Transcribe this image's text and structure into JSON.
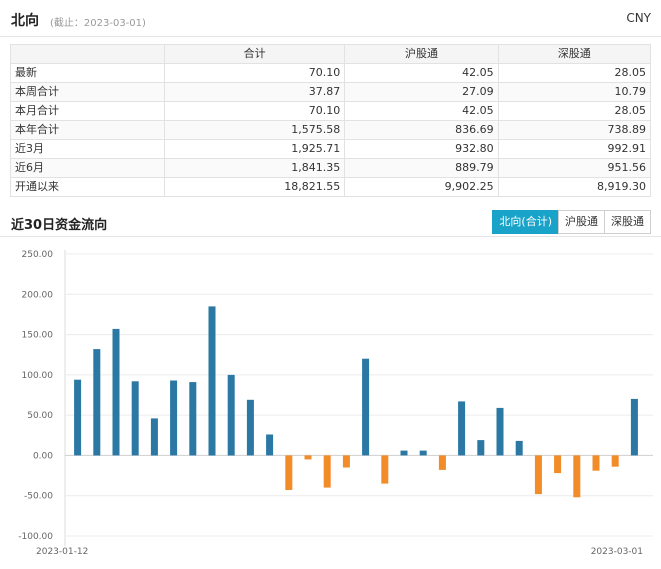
{
  "header": {
    "title": "北向",
    "subtitle": "(截止：2023-03-01)",
    "currency": "CNY"
  },
  "table": {
    "columns": [
      "",
      "合计",
      "沪股通",
      "深股通"
    ],
    "rows": [
      {
        "label": "最新",
        "total": "70.10",
        "sh": "42.05",
        "sz": "28.05"
      },
      {
        "label": "本周合计",
        "total": "37.87",
        "sh": "27.09",
        "sz": "10.79"
      },
      {
        "label": "本月合计",
        "total": "70.10",
        "sh": "42.05",
        "sz": "28.05"
      },
      {
        "label": "本年合计",
        "total": "1,575.58",
        "sh": "836.69",
        "sz": "738.89"
      },
      {
        "label": "近3月",
        "total": "1,925.71",
        "sh": "932.80",
        "sz": "992.91"
      },
      {
        "label": "近6月",
        "total": "1,841.35",
        "sh": "889.79",
        "sz": "951.56"
      },
      {
        "label": "开通以来",
        "total": "18,821.55",
        "sh": "9,902.25",
        "sz": "8,919.30"
      }
    ]
  },
  "section": {
    "title": "近30日资金流向",
    "tabs": [
      "北向(合计)",
      "沪股通",
      "深股通"
    ],
    "active_tab": 0
  },
  "colors": {
    "positive": "#2a78a3",
    "negative": "#f28c28",
    "accent": "#1aa3c8"
  },
  "chart_data": {
    "type": "bar",
    "x_start_label": "2023-01-12",
    "x_end_label": "2023-03-01",
    "yticks": [
      "250.00",
      "200.00",
      "150.00",
      "100.00",
      "50.00",
      "0.00",
      "-50.00",
      "-100.00"
    ],
    "ylim": [
      -100,
      250
    ],
    "values": [
      94,
      132,
      157,
      92,
      46,
      93,
      91,
      185,
      100,
      69,
      26,
      -43,
      -5,
      -40,
      -15,
      120,
      -35,
      6,
      6,
      -18,
      67,
      19,
      59,
      18,
      -48,
      -22,
      -52,
      -19,
      -14,
      70.1
    ]
  }
}
